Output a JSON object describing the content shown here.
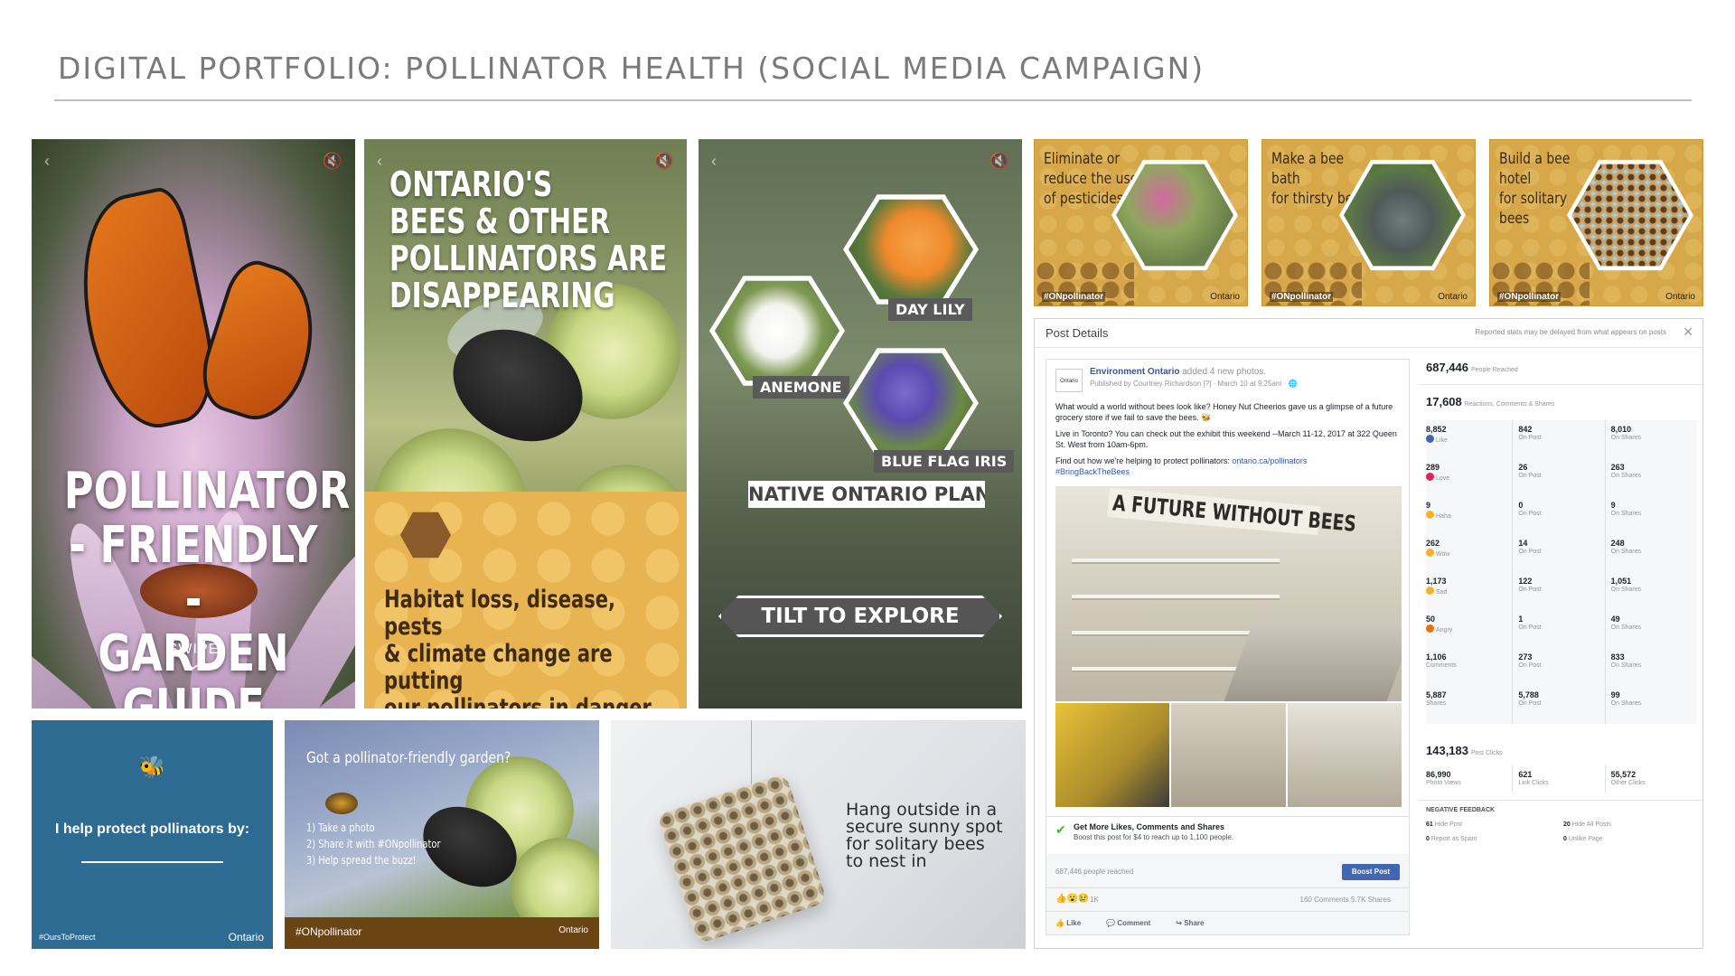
{
  "page": {
    "title": "DIGITAL PORTFOLIO: POLLINATOR HEALTH (SOCIAL MEDIA CAMPAIGN)"
  },
  "story1": {
    "headline_lines": [
      "POLLINATOR",
      "- FRIENDLY -",
      "GARDEN GUIDE"
    ],
    "swipe": "SWIPE"
  },
  "story2": {
    "headline_lines": [
      "ONTARIO'S",
      "BEES & OTHER",
      "POLLINATORS ARE",
      "DISAPPEARING"
    ],
    "footer_lines": [
      "Habitat loss, disease, pests",
      "& climate change are putting",
      "our pollinators in danger."
    ]
  },
  "story3": {
    "labels": {
      "anemone": "ANEMONE",
      "daylily": "DAY LILY",
      "iris": "BLUE FLAG IRIS"
    },
    "banner": "NATIVE ONTARIO PLANTS",
    "tilt": "TILT TO EXPLORE"
  },
  "tiles": [
    {
      "text_lines": [
        "Eliminate or",
        "reduce the use",
        "of pesticides"
      ],
      "tag": "#ONpollinator",
      "logo": "Ontario"
    },
    {
      "text_lines": [
        "Make a bee bath",
        "for thirsty bees"
      ],
      "tag": "#ONpollinator",
      "logo": "Ontario"
    },
    {
      "text_lines": [
        "Build a bee hotel",
        "for solitary bees"
      ],
      "tag": "#ONpollinator",
      "logo": "Ontario"
    }
  ],
  "fb": {
    "header": "Post Details",
    "note": "Reported stats may be delayed from what appears on posts",
    "page_name": "Environment Ontario",
    "added": "added 4 new photos.",
    "published": "Published by Courtney Richardson [?] · March 10 at 9:25am · ",
    "avatar": "Ontario",
    "para1": "What would a world without bees look like? Honey Nut Cheerios gave us a glimpse of a future grocery store if we fail to save the bees. 🐝",
    "para2": "Live in Toronto? You can check out the exhibit this weekend --March 11-12, 2017 at 322 Queen St. West from 10am-6pm.",
    "para3_prefix": "Find out how we're helping to protect pollinators: ",
    "para3_link": "ontario.ca/pollinators",
    "hashtag": "#BringBackTheBees",
    "photo_sign": "A FUTURE WITHOUT BEES",
    "boost_title": "Get More Likes, Comments and Shares",
    "boost_sub": "Boost this post for $4 to reach up to 1,100 people.",
    "reach": "687,446 people reached",
    "boost_btn": "Boost Post",
    "reactions_count": "1K",
    "comments_shares": "160 Comments  5.7K Shares",
    "like": "Like",
    "comment": "Comment",
    "share": "Share",
    "people_reached": "687,446",
    "people_reached_lbl": "People Reached",
    "reactions_total": "17,608",
    "reactions_total_lbl": "Reactions, Comments & Shares",
    "rows": [
      {
        "kind": "Like",
        "total": "8,852",
        "post": "842",
        "shares": "8,010"
      },
      {
        "kind": "Love",
        "total": "289",
        "post": "26",
        "shares": "263"
      },
      {
        "kind": "Haha",
        "total": "9",
        "post": "0",
        "shares": "9"
      },
      {
        "kind": "Wow",
        "total": "262",
        "post": "14",
        "shares": "248"
      },
      {
        "kind": "Sad",
        "total": "1,173",
        "post": "122",
        "shares": "1,051"
      },
      {
        "kind": "Angry",
        "total": "50",
        "post": "1",
        "shares": "49"
      },
      {
        "kind": "Comments",
        "total": "1,106",
        "post": "273",
        "shares": "833"
      },
      {
        "kind": "Shares",
        "total": "5,887",
        "post": "5,788",
        "shares": "99"
      }
    ],
    "on_post": "On Post",
    "on_shares": "On Shares",
    "post_clicks": "143,183",
    "post_clicks_lbl": "Post Clicks",
    "photo_views": "86,990",
    "photo_views_lbl": "Photo Views",
    "link_clicks": "621",
    "link_clicks_lbl": "Link Clicks",
    "other_clicks": "55,572",
    "other_clicks_lbl": "Other Clicks",
    "neg_title": "NEGATIVE FEEDBACK",
    "hide_post": "61",
    "hide_post_lbl": "Hide Post",
    "hide_all": "20",
    "hide_all_lbl": "Hide All Posts",
    "report_spam": "0",
    "report_spam_lbl": "Report as Spam",
    "unlike": "0",
    "unlike_lbl": "Unlike Page"
  },
  "help": {
    "text": "I help protect pollinators by:",
    "tag": "#OursToProtect",
    "logo": "Ontario"
  },
  "garden": {
    "question": "Got a pollinator-friendly garden?",
    "steps": [
      "1) Take a photo",
      "2) Share it with #ONpollinator",
      "3) Help spread the buzz!"
    ],
    "tag": "#ONpollinator",
    "logo": "Ontario"
  },
  "hotel": {
    "text_lines": [
      "Hang outside in a",
      "secure sunny spot",
      "for solitary bees",
      "to nest in"
    ]
  },
  "colors": {
    "honey": "#d6a84a",
    "ontario_blue": "#2d6b93",
    "fb_blue": "#4267b2",
    "dark_brown": "#6b4414"
  }
}
